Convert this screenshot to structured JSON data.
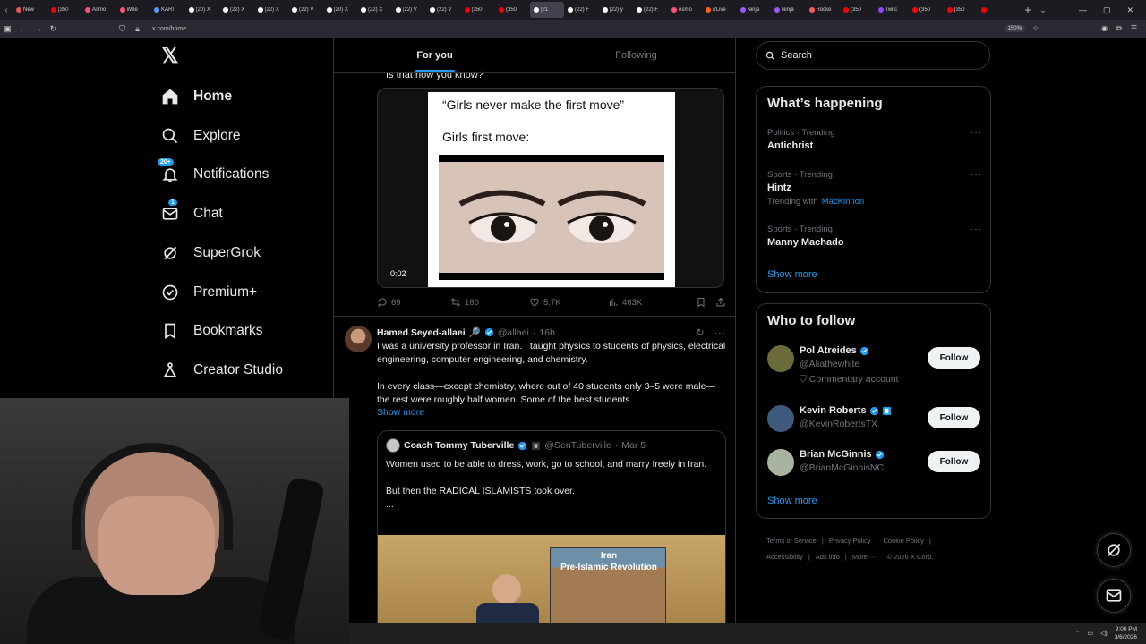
{
  "browser": {
    "tabs": [
      {
        "label": "New",
        "color": "#e25757",
        "active": false
      },
      {
        "label": "(350",
        "color": "#ff0000",
        "active": false
      },
      {
        "label": "Asmo",
        "color": "#ff4f7a",
        "active": false
      },
      {
        "label": "Whe",
        "color": "#ff4f7a",
        "active": false
      },
      {
        "label": "KARI",
        "color": "#4fa3ff",
        "active": false
      },
      {
        "label": "(20) X",
        "color": "#ffffff",
        "active": false
      },
      {
        "label": "(22) X",
        "color": "#ffffff",
        "active": false
      },
      {
        "label": "(22) X",
        "color": "#ffffff",
        "active": false
      },
      {
        "label": "(22) V",
        "color": "#ffffff",
        "active": false
      },
      {
        "label": "(20) X",
        "color": "#ffffff",
        "active": false
      },
      {
        "label": "(22) X",
        "color": "#ffffff",
        "active": false
      },
      {
        "label": "(22) V",
        "color": "#ffffff",
        "active": false
      },
      {
        "label": "(22) V",
        "color": "#ffffff",
        "active": false
      },
      {
        "label": "(350",
        "color": "#ff0000",
        "active": false
      },
      {
        "label": "(350",
        "color": "#ff0000",
        "active": false
      },
      {
        "label": "(21",
        "color": "#ffffff",
        "active": true
      },
      {
        "label": "(22) F",
        "color": "#ffffff",
        "active": false
      },
      {
        "label": "(22) y",
        "color": "#ffffff",
        "active": false
      },
      {
        "label": "(22) F",
        "color": "#ffffff",
        "active": false
      },
      {
        "label": "Asmo",
        "color": "#ff4f7a",
        "active": false
      },
      {
        "label": "r/Live",
        "color": "#ff6314",
        "active": false
      },
      {
        "label": "Ninja",
        "color": "#9b59ff",
        "active": false
      },
      {
        "label": "Ninja",
        "color": "#9b59ff",
        "active": false
      },
      {
        "label": "Rocke",
        "color": "#ff5a5a",
        "active": false
      },
      {
        "label": "(350",
        "color": "#ff0000",
        "active": false
      },
      {
        "label": "Twitc",
        "color": "#9146ff",
        "active": false
      },
      {
        "label": "(350",
        "color": "#ff0000",
        "active": false
      },
      {
        "label": "(350",
        "color": "#ff0000",
        "active": false
      },
      {
        "label": "",
        "color": "#ff0000",
        "active": false
      }
    ],
    "url": "x.com/home",
    "zoom": "150%"
  },
  "nav": {
    "items": [
      {
        "label": "Home",
        "icon": "home-icon",
        "bold": true
      },
      {
        "label": "Explore",
        "icon": "search-icon"
      },
      {
        "label": "Notifications",
        "icon": "bell-icon",
        "badge": "20+"
      },
      {
        "label": "Chat",
        "icon": "mail-icon",
        "badge": "1"
      },
      {
        "label": "SuperGrok",
        "icon": "grok-icon"
      },
      {
        "label": "Premium+",
        "icon": "premium-icon"
      },
      {
        "label": "Bookmarks",
        "icon": "bookmark-icon"
      },
      {
        "label": "Creator Studio",
        "icon": "flask-icon"
      }
    ]
  },
  "timeline": {
    "tabs": [
      "For you",
      "Following"
    ],
    "post1": {
      "text": "Is that how you know?",
      "meme_line1": "“Girls never make the first move”",
      "meme_line2": "Girls first move:",
      "video_time": "0:02",
      "replies": "69",
      "reposts": "160",
      "likes": "5.7K",
      "views": "463K"
    },
    "post2": {
      "name": "Hamed Seyed-allaei",
      "emoji": "🔎",
      "handle": "@allaei",
      "time": "16h",
      "body1": "I was a university professor in Iran. I taught physics to students of physics, electrical engineering, computer engineering, and chemistry.",
      "body2": "In every class—except chemistry, where out of 40 students only 3–5 were male—the rest were roughly half women. Some of the best students",
      "show_more": "Show more",
      "quote": {
        "name": "Coach Tommy Tuberville",
        "handle": "@SenTuberville",
        "date": "Mar 5",
        "line1": "Women used to be able to dress, work, go to school, and marry freely in Iran.",
        "line2": "But then the RADICAL ISLAMISTS took over.",
        "line3": "...",
        "book_title1": "Iran",
        "book_title2": "Pre-Islamic Revolution"
      }
    }
  },
  "sidebar": {
    "search_placeholder": "Search",
    "trending_title": "What’s happening",
    "trends": [
      {
        "category": "Politics · Trending",
        "topic": "Antichrist"
      },
      {
        "category": "Sports · Trending",
        "topic": "Hintz",
        "with_prefix": "Trending with",
        "with": "MacKinnon"
      },
      {
        "category": "Sports · Trending",
        "topic": "Manny Machado"
      }
    ],
    "trends_show_more": "Show more",
    "wtf_title": "Who to follow",
    "wtf": [
      {
        "name": "Pol Atreides",
        "handle": "@Aliathewhite",
        "desc": "Commentary account",
        "button": "Follow",
        "avatar_color": "#6b6a3a"
      },
      {
        "name": "Kevin Roberts",
        "handle": "@KevinRobertsTX",
        "button": "Follow",
        "avatar_color": "#3f5a7c"
      },
      {
        "name": "Brian McGinnis",
        "handle": "@BrianMcGinnisNC",
        "button": "Follow",
        "avatar_color": "#a8b3a0"
      }
    ],
    "wtf_show_more": "Show more",
    "footer": {
      "terms": "Terms of Service",
      "privacy": "Privacy Policy",
      "cookie": "Cookie Policy",
      "accessibility": "Accessibility",
      "ads": "Ads info",
      "more": "More ···",
      "copyright": "© 2026 X Corp."
    }
  },
  "taskbar": {
    "time": "9:00 PM",
    "date": "3/6/2026"
  },
  "colors": {
    "accent": "#1d9bf0",
    "background": "#000000",
    "border": "#2f3336"
  }
}
